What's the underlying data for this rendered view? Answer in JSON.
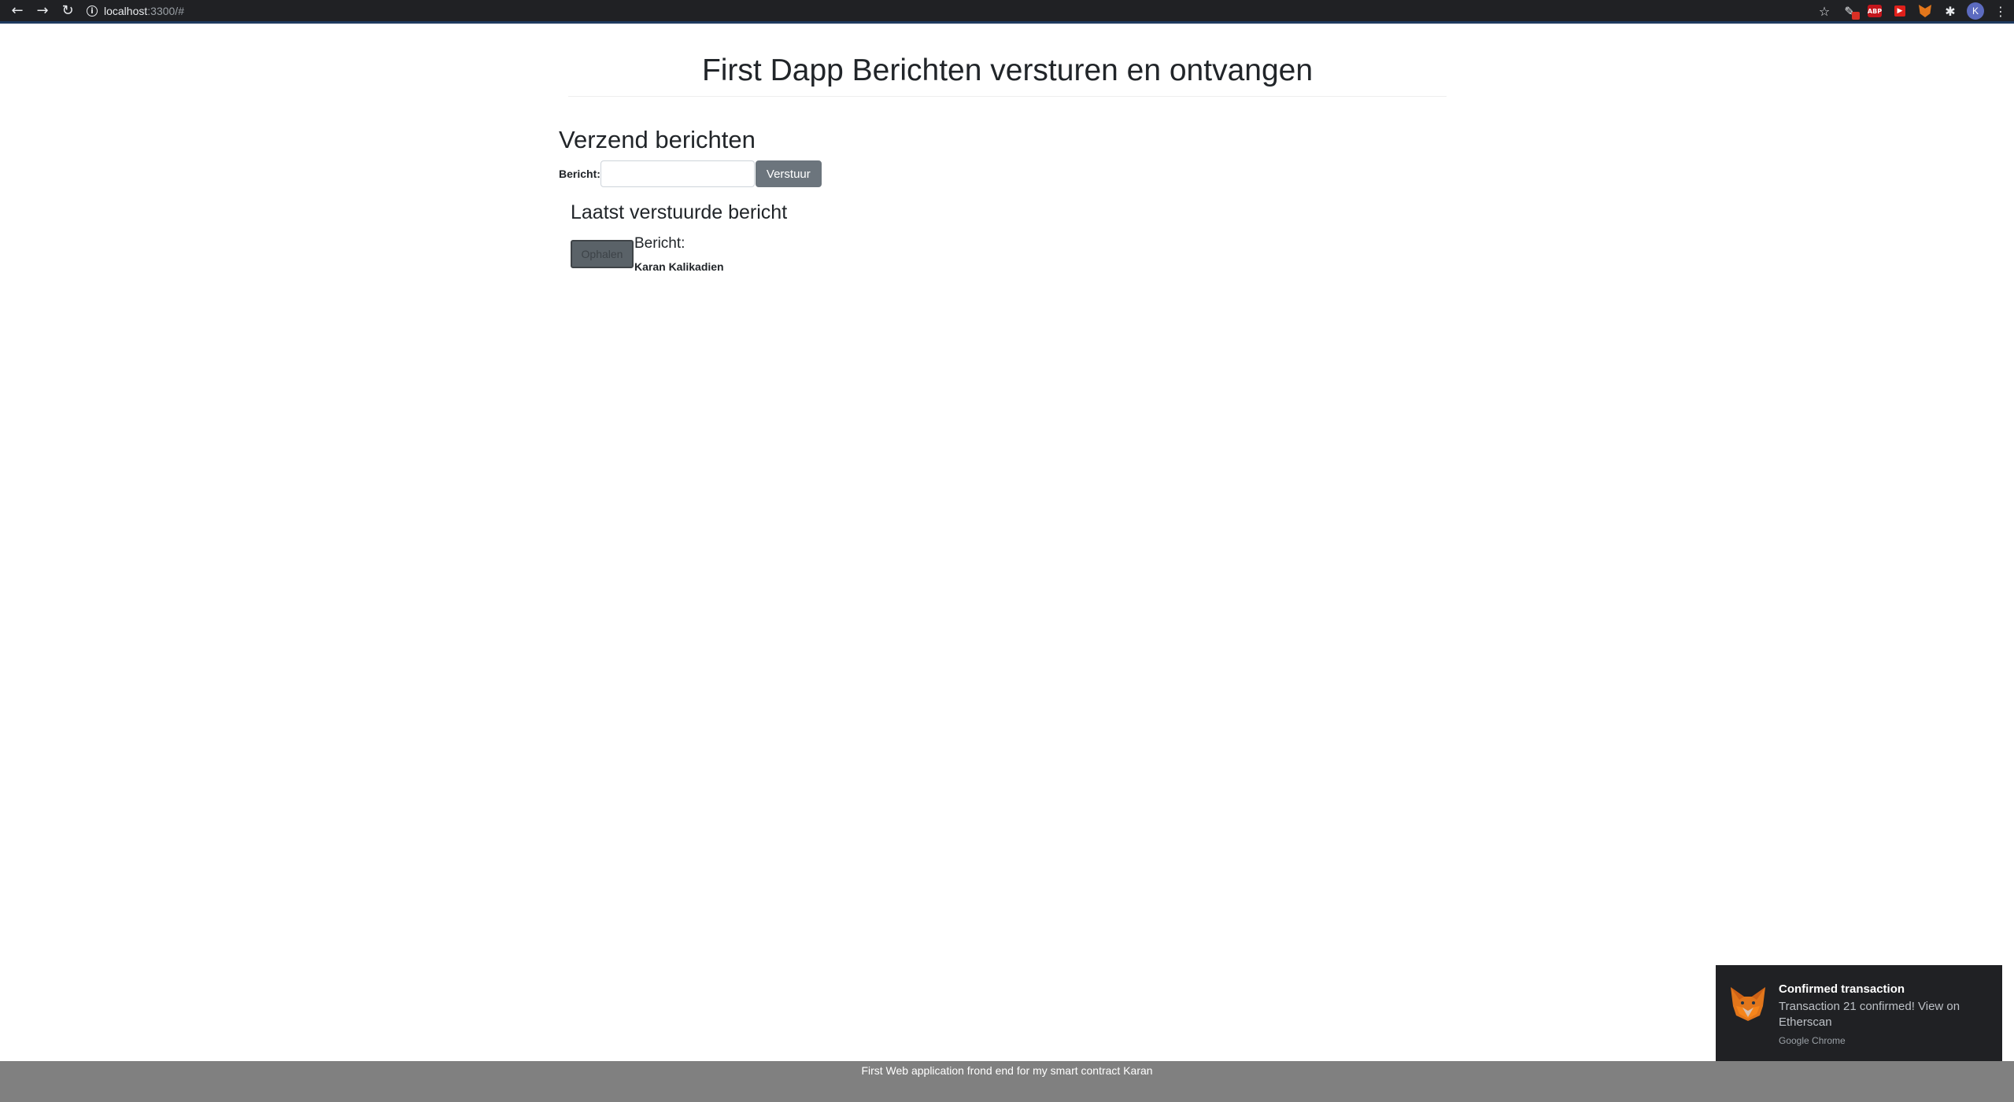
{
  "browser": {
    "url_host": "localhost",
    "url_rest": ":3300/#",
    "avatar_letter": "K",
    "abp_label": "ABP"
  },
  "page": {
    "title": "First Dapp Berichten versturen en ontvangen"
  },
  "send_section": {
    "heading": "Verzend berichten",
    "field_label": "Bericht:",
    "input_value": "",
    "input_placeholder": "",
    "send_button": "Verstuur"
  },
  "last_section": {
    "heading": "Laatst verstuurde bericht",
    "fetch_button": "Ophalen",
    "message_label": "Bericht:",
    "message_value": "Karan Kalikadien"
  },
  "footer": {
    "text": "First Web application frond end for my smart contract Karan"
  },
  "notification": {
    "title": "Confirmed transaction",
    "body": "Transaction 21 confirmed! View on Etherscan",
    "source": "Google Chrome",
    "icon": "metamask-fox-icon"
  },
  "colors": {
    "chrome_bg": "#202124",
    "button_secondary": "#6c757d",
    "footer_bg": "#808080"
  }
}
